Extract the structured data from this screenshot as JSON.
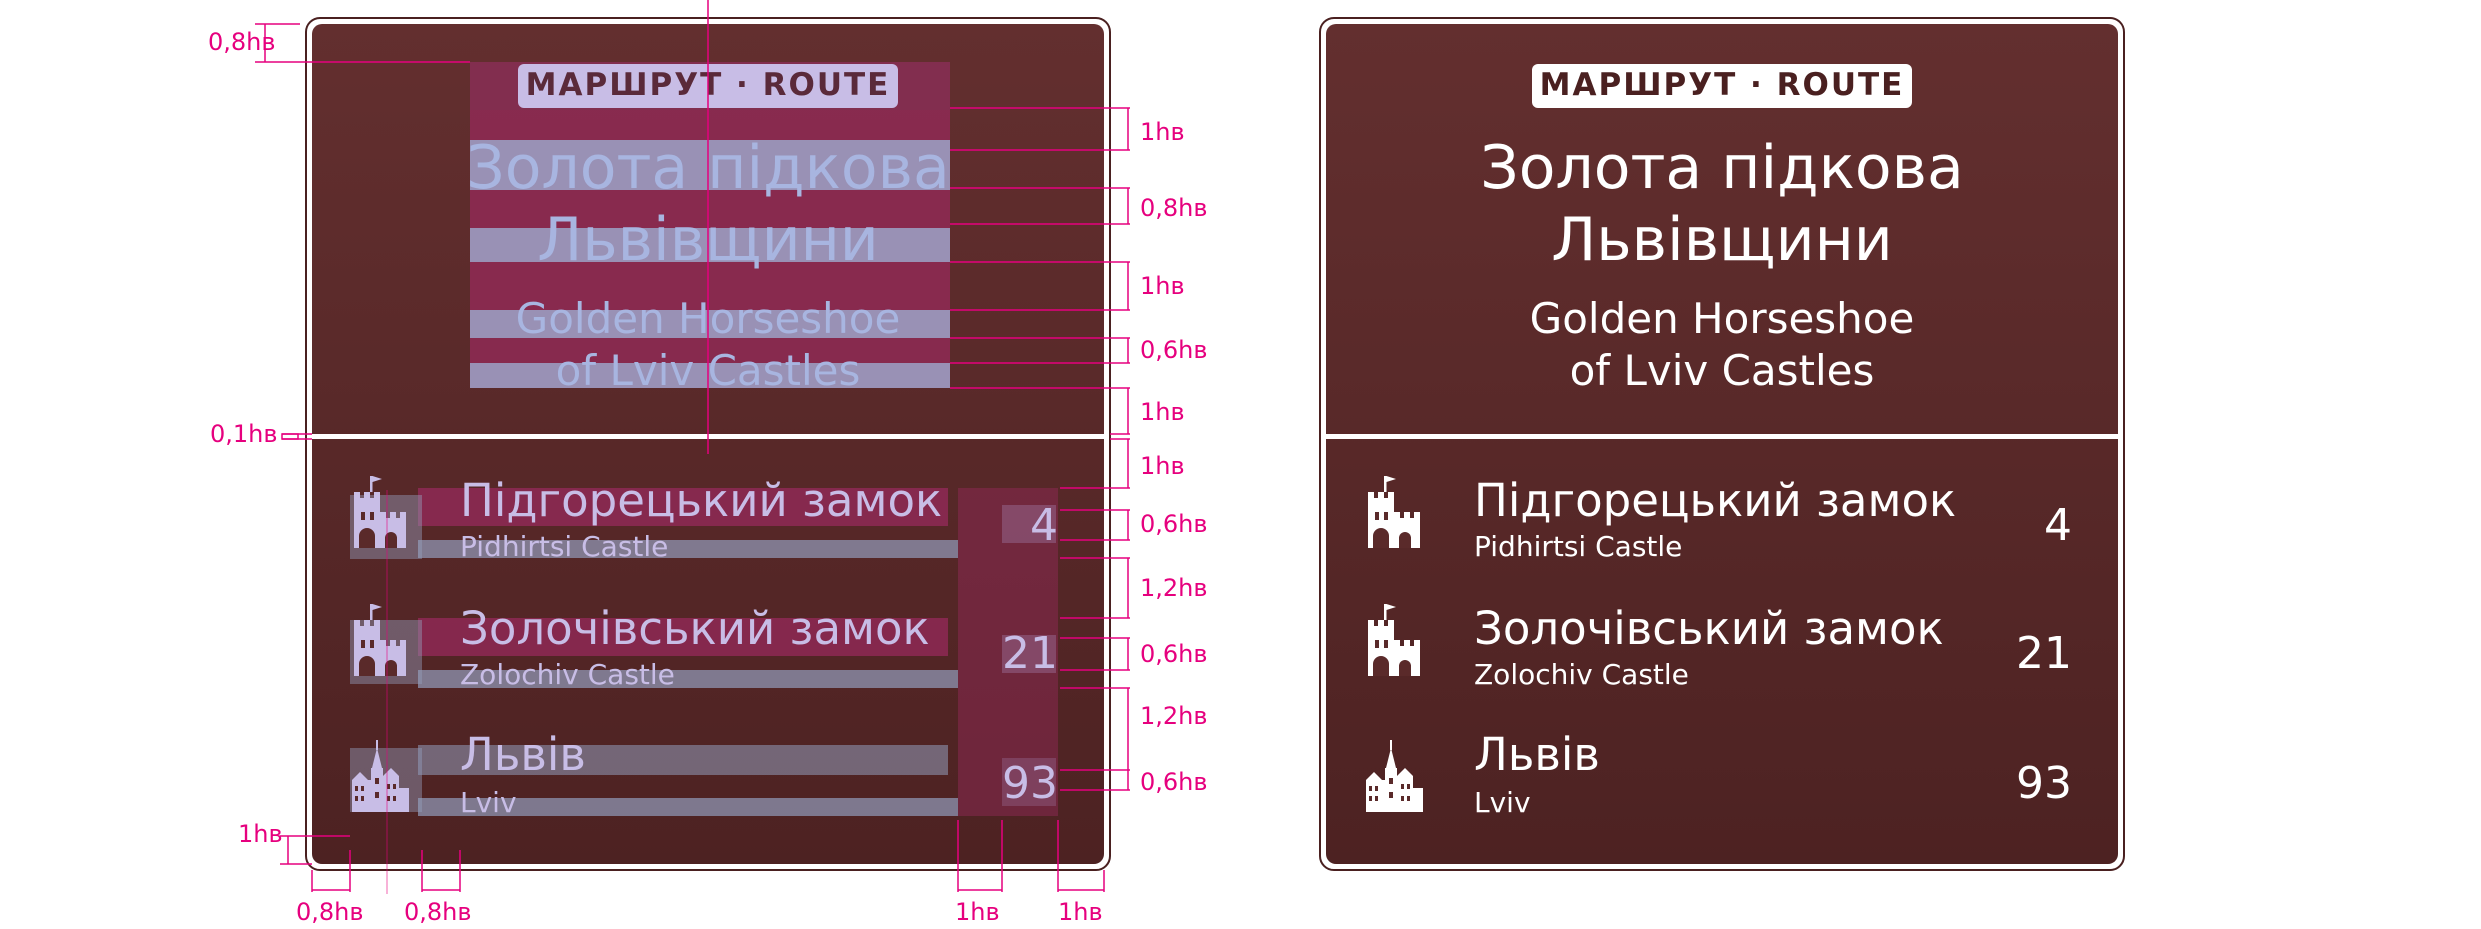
{
  "colors": {
    "sign_brown": "#5a2a2a",
    "sign_brown_dark": "#4a2020",
    "border": "#ffffff",
    "dim_magenta": "#e6007e",
    "band_pink": "#9e2f5c",
    "band_blue": "#9fb4d8",
    "text_overlay": "#c8bde6",
    "header_overlay": "#a8b5e0"
  },
  "sign": {
    "badge": "МАРШРУТ · ROUTE",
    "title_ua_line1": "Золота підкова",
    "title_ua_line2": "Львівщини",
    "title_en_line1": "Golden Horseshoe",
    "title_en_line2": "of Lviv Castles",
    "destinations": [
      {
        "name": "Підгорецький замок",
        "name_en": "Pidhirtsi Castle",
        "distance": "4",
        "icon": "castle-icon"
      },
      {
        "name": "Золочівський замок",
        "name_en": "Zolochiv Castle",
        "distance": "21",
        "icon": "castle-icon"
      },
      {
        "name": "Львів",
        "name_en": "Lviv",
        "distance": "93",
        "icon": "city-icon"
      }
    ]
  },
  "dimensions": {
    "left": {
      "top_margin": "0,8hв",
      "divider": "0,1hв",
      "bottom_margin": "1hв"
    },
    "right": [
      "1hв",
      "0,8hв",
      "1hв",
      "0,6hв",
      "1hв",
      "1hв",
      "0,6hв",
      "1,2hв",
      "0,6hв",
      "1,2hв",
      "0,6hв"
    ],
    "bottom": [
      "0,8hв",
      "0,8hв",
      "1hв",
      "1hв"
    ]
  }
}
